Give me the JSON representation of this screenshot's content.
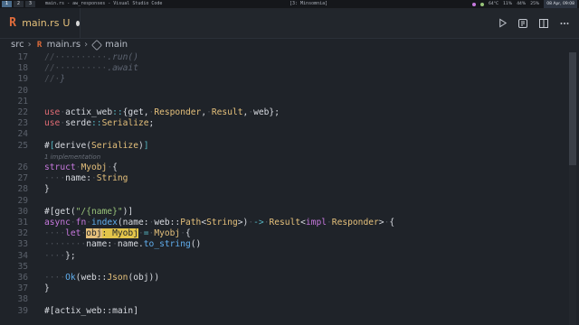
{
  "topbar": {
    "workspaces": [
      "1",
      "2",
      "3"
    ],
    "window_title": "main.rs - aw_responses - Visual Studio Code",
    "center_title": "[3: Minsomnia]",
    "tray": {
      "cpu": "64°C",
      "vol": "11%",
      "bat": "44%",
      "mem": "25%",
      "clock": "08 Apr, 09:08"
    },
    "colors": {
      "accent": "#4a6b8a"
    }
  },
  "tab": {
    "icon": "rust-file-icon",
    "name": "main.rs",
    "status": "U"
  },
  "actions": [
    "run-icon",
    "diff-icon",
    "split-editor-icon",
    "more-icon"
  ],
  "breadcrumb": {
    "folder": "src",
    "file": "main.rs",
    "symbol": "main"
  },
  "lines": [
    {
      "n": "17",
      "parts": [
        [
          "ws",
          "//··········"
        ],
        [
          "cm",
          ".run()"
        ]
      ]
    },
    {
      "n": "18",
      "parts": [
        [
          "ws",
          "//··········"
        ],
        [
          "cm",
          ".await"
        ]
      ]
    },
    {
      "n": "19",
      "parts": [
        [
          "ws",
          "//·"
        ],
        [
          "cm",
          "}"
        ]
      ]
    },
    {
      "n": "20",
      "parts": []
    },
    {
      "n": "21",
      "parts": []
    },
    {
      "n": "22",
      "parts": [
        [
          "kw2",
          "use"
        ],
        [
          "ws",
          "·"
        ],
        [
          "pl",
          "actix_web"
        ],
        [
          "op",
          "::"
        ],
        [
          "pl",
          "{get,"
        ],
        [
          "ws",
          "·"
        ],
        [
          "ty",
          "Responder"
        ],
        [
          "pl",
          ","
        ],
        [
          "ws",
          "·"
        ],
        [
          "ty",
          "Result"
        ],
        [
          "pl",
          ","
        ],
        [
          "ws",
          "·"
        ],
        [
          "pl",
          "web};"
        ]
      ]
    },
    {
      "n": "23",
      "parts": [
        [
          "kw2",
          "use"
        ],
        [
          "ws",
          "·"
        ],
        [
          "pl",
          "serde"
        ],
        [
          "op",
          "::"
        ],
        [
          "ty",
          "Serialize"
        ],
        [
          "pl",
          ";"
        ]
      ]
    },
    {
      "n": "24",
      "parts": []
    },
    {
      "n": "25",
      "parts": [
        [
          "pl",
          "#"
        ],
        [
          "op",
          "["
        ],
        [
          "pl",
          "derive("
        ],
        [
          "ty",
          "Serialize"
        ],
        [
          "pl",
          ")"
        ],
        [
          "op",
          "]"
        ]
      ]
    },
    {
      "n": "",
      "parts": [
        [
          "hint",
          "1 implementation"
        ]
      ]
    },
    {
      "n": "26",
      "parts": [
        [
          "kw",
          "struct"
        ],
        [
          "ws",
          "·"
        ],
        [
          "ty",
          "Myobj"
        ],
        [
          "ws",
          "·"
        ],
        [
          "pl",
          "{"
        ]
      ]
    },
    {
      "n": "27",
      "parts": [
        [
          "ws",
          "····"
        ],
        [
          "pl",
          "name:"
        ],
        [
          "ws",
          "·"
        ],
        [
          "ty",
          "String"
        ]
      ]
    },
    {
      "n": "28",
      "parts": [
        [
          "pl",
          "}"
        ]
      ]
    },
    {
      "n": "29",
      "parts": []
    },
    {
      "n": "30",
      "parts": [
        [
          "pl",
          "#[get("
        ],
        [
          "str",
          "\"/{name}\""
        ],
        [
          "pl",
          ")]"
        ]
      ]
    },
    {
      "n": "31",
      "parts": [
        [
          "kw",
          "async"
        ],
        [
          "ws",
          "·"
        ],
        [
          "kw",
          "fn"
        ],
        [
          "ws",
          "·"
        ],
        [
          "fn",
          "index"
        ],
        [
          "pl",
          "(name:"
        ],
        [
          "ws",
          "·"
        ],
        [
          "pl",
          "web::"
        ],
        [
          "ty",
          "Path"
        ],
        [
          "pl",
          "<"
        ],
        [
          "ty",
          "String"
        ],
        [
          "pl",
          ">)"
        ],
        [
          "ws",
          "·"
        ],
        [
          "op",
          "->"
        ],
        [
          "ws",
          "·"
        ],
        [
          "ty",
          "Result"
        ],
        [
          "pl",
          "<"
        ],
        [
          "kw",
          "impl"
        ],
        [
          "ws",
          "·"
        ],
        [
          "ty",
          "Responder"
        ],
        [
          "pl",
          ">"
        ],
        [
          "ws",
          "·"
        ],
        [
          "pl",
          "{"
        ]
      ]
    },
    {
      "n": "32",
      "parts": [
        [
          "ws",
          "····"
        ],
        [
          "kw",
          "let"
        ],
        [
          "ws",
          "·"
        ],
        [
          "hl",
          "obj"
        ],
        [
          "inlay",
          ": Myobj"
        ],
        [
          "ws",
          "·"
        ],
        [
          "op",
          "="
        ],
        [
          "ws",
          "·"
        ],
        [
          "ty",
          "Myobj"
        ],
        [
          "ws",
          "·"
        ],
        [
          "pl",
          "{"
        ]
      ]
    },
    {
      "n": "33",
      "parts": [
        [
          "ws",
          "········"
        ],
        [
          "pl",
          "name:"
        ],
        [
          "ws",
          "·"
        ],
        [
          "pl",
          "name."
        ],
        [
          "fn",
          "to_string"
        ],
        [
          "pl",
          "()"
        ]
      ]
    },
    {
      "n": "34",
      "parts": [
        [
          "ws",
          "····"
        ],
        [
          "pl",
          "};"
        ]
      ]
    },
    {
      "n": "35",
      "parts": []
    },
    {
      "n": "36",
      "parts": [
        [
          "ws",
          "····"
        ],
        [
          "fn",
          "Ok"
        ],
        [
          "pl",
          "(web::"
        ],
        [
          "ty",
          "Json"
        ],
        [
          "pl",
          "(obj))"
        ]
      ]
    },
    {
      "n": "37",
      "parts": [
        [
          "pl",
          "}"
        ]
      ]
    },
    {
      "n": "38",
      "parts": []
    },
    {
      "n": "39",
      "parts": [
        [
          "pl",
          "#[actix_web::main]"
        ]
      ]
    }
  ]
}
